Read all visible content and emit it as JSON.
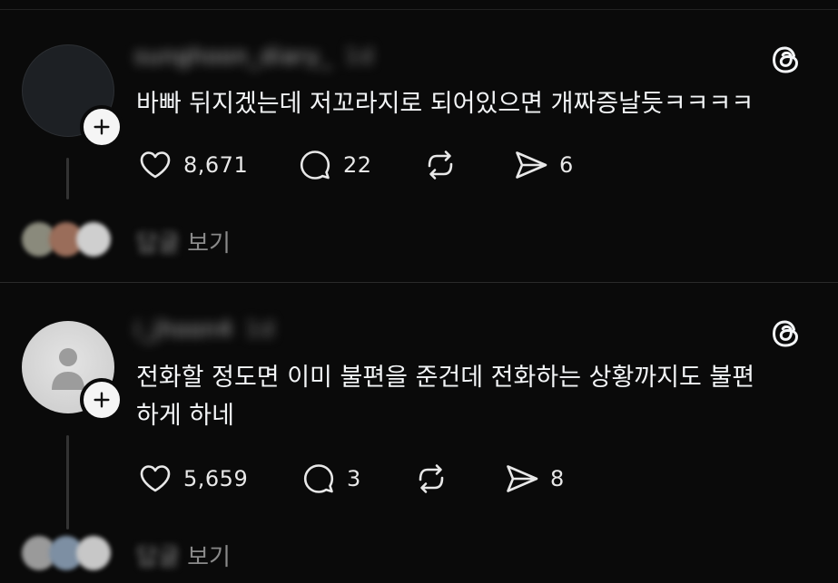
{
  "posts": [
    {
      "username": "sunghoon_diary_",
      "time": "1d",
      "text": "바빠 뒤지겠는데 저꼬라지로 되어있으면 개짜증날듯ㅋㅋㅋㅋ",
      "likes": "8,671",
      "comments": "22",
      "reposts": "",
      "shares": "6",
      "replies_prefix": "답글",
      "replies_label": "보기",
      "avatar_type": "dark",
      "reply_avatar_colors": [
        "#8a8a7c",
        "#9a6d5a",
        "#cfcfcf"
      ]
    },
    {
      "username": "i_jhoon4",
      "time": "1d",
      "text": "전화할 정도면 이미 불편을 준건데 전화하는 상황까지도 불편\n하게 하네",
      "likes": "5,659",
      "comments": "3",
      "reposts": "",
      "shares": "8",
      "replies_prefix": "답글",
      "replies_label": "보기",
      "avatar_type": "default",
      "reply_avatar_colors": [
        "#9a9a9a",
        "#7d8fa3",
        "#c7c7c7"
      ]
    }
  ],
  "icons": {
    "like": "heart-icon",
    "comment": "comment-icon",
    "repost": "repost-icon",
    "share": "share-icon",
    "brand": "threads-logo-icon",
    "follow": "plus-icon"
  },
  "colors": {
    "background": "#0a0a0a",
    "text": "#f3f5f7",
    "muted": "#8a8a8a"
  }
}
